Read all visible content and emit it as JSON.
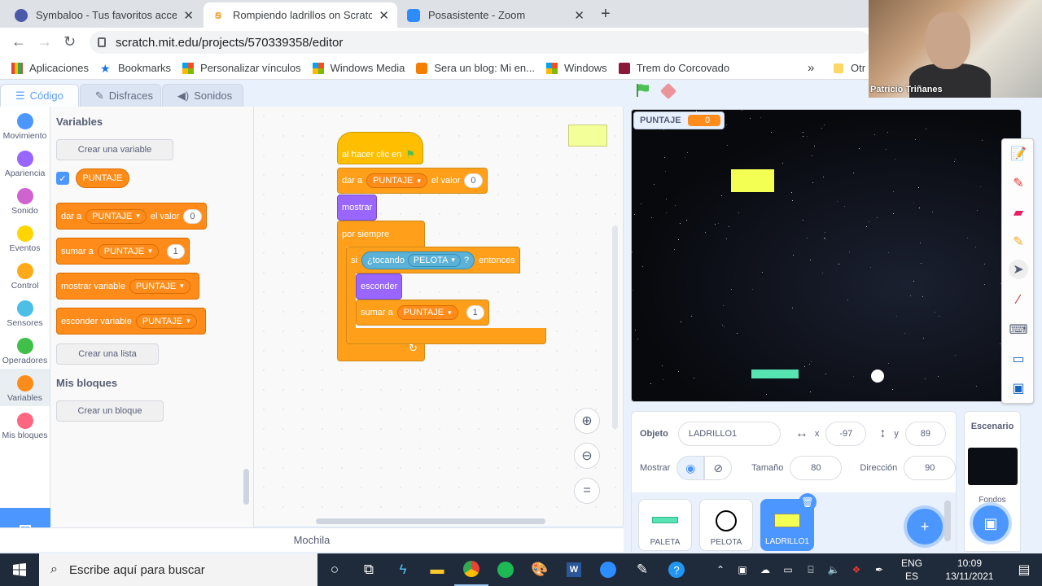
{
  "browser": {
    "tabs": [
      {
        "label": "Symbaloo - Tus favoritos accesib",
        "icon_color": "#4b5aa8"
      },
      {
        "label": "Rompiendo ladrillos on Scratch",
        "icon_color": "#f7a334"
      },
      {
        "label": "Posasistente - Zoom",
        "icon_color": "#2d8cff"
      }
    ],
    "url": "scratch.mit.edu/projects/570339358/editor",
    "bookmarks": [
      {
        "label": "Aplicaciones",
        "icon": "apps-grid-icon"
      },
      {
        "label": "Bookmarks",
        "icon": "star-icon"
      },
      {
        "label": "Personalizar vínculos",
        "icon": "windows-logo-icon"
      },
      {
        "label": "Windows Media",
        "icon": "windows-logo-icon"
      },
      {
        "label": "Sera un blog: Mi en...",
        "icon": "blogger-icon"
      },
      {
        "label": "Windows",
        "icon": "windows-logo-icon"
      },
      {
        "label": "Trem do Corcovado",
        "icon": "site-icon"
      }
    ],
    "bookmarks_overflow": "»",
    "bookmarks_other": "Otr"
  },
  "editor": {
    "tabs": {
      "code": "Código",
      "costumes": "Disfraces",
      "sounds": "Sonidos"
    },
    "categories": [
      {
        "label": "Movimiento",
        "color": "#4c97ff"
      },
      {
        "label": "Apariencia",
        "color": "#9966ff"
      },
      {
        "label": "Sonido",
        "color": "#cf63cf"
      },
      {
        "label": "Eventos",
        "color": "#ffd500"
      },
      {
        "label": "Control",
        "color": "#ffab19"
      },
      {
        "label": "Sensores",
        "color": "#4cbfe6"
      },
      {
        "label": "Operadores",
        "color": "#40bf4a"
      },
      {
        "label": "Variables",
        "color": "#ff8c1a"
      },
      {
        "label": "Mis bloques",
        "color": "#ff6680"
      }
    ],
    "palette": {
      "variables_title": "Variables",
      "create_variable": "Crear una variable",
      "variable_name": "PUNTAJE",
      "set_block": {
        "prefix": "dar a",
        "var": "PUNTAJE",
        "mid": "el valor",
        "value": "0"
      },
      "change_block": {
        "prefix": "sumar a",
        "var": "PUNTAJE",
        "value": "1"
      },
      "show_block": {
        "prefix": "mostrar variable",
        "var": "PUNTAJE"
      },
      "hide_block": {
        "prefix": "esconder variable",
        "var": "PUNTAJE"
      },
      "create_list": "Crear una lista",
      "myblocks_title": "Mis bloques",
      "create_block": "Crear un bloque"
    },
    "script": {
      "when_flag": "al hacer clic en",
      "set_prefix": "dar a",
      "set_var": "PUNTAJE",
      "set_mid": "el valor",
      "set_value": "0",
      "show": "mostrar",
      "forever": "por siempre",
      "if": "si",
      "touching": "¿tocando",
      "touching_target": "PELOTA",
      "question": "?",
      "then": "entonces",
      "hide": "esconder",
      "change_prefix": "sumar a",
      "change_var": "PUNTAJE",
      "change_value": "1",
      "loop_arrow": "↻"
    },
    "backpack": "Mochila"
  },
  "stage": {
    "monitor_label": "PUNTAJE",
    "monitor_value": "0",
    "sprite_info": {
      "sprite_label": "Objeto",
      "sprite_name": "LADRILLO1",
      "x_label": "x",
      "x_value": "-97",
      "y_label": "y",
      "y_value": "89",
      "show_label": "Mostrar",
      "size_label": "Tamaño",
      "size_value": "80",
      "direction_label": "Dirección",
      "direction_value": "90"
    },
    "sprites": [
      {
        "name": "PALETA"
      },
      {
        "name": "PELOTA"
      },
      {
        "name": "LADRILLO1"
      }
    ],
    "stage_panel_title": "Escenario",
    "backdrops_label": "Fondos"
  },
  "zoom": {
    "participant": "Patricio Triñanes"
  },
  "taskbar": {
    "search_placeholder": "Escribe aquí para buscar",
    "lang_top": "ENG",
    "lang_bottom": "ES",
    "time": "10:09",
    "date": "13/11/2021"
  }
}
